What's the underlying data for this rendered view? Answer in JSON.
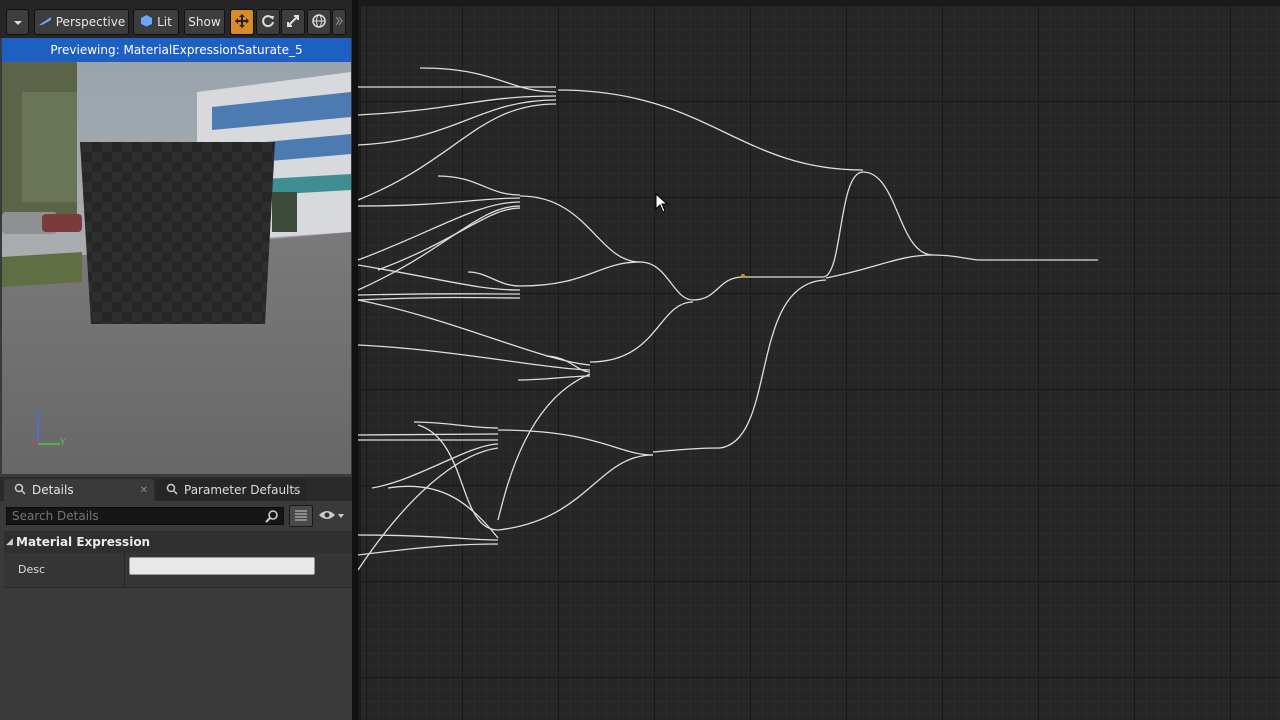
{
  "toolbar": {
    "perspective_label": "Perspective",
    "lit_label": "Lit",
    "show_label": "Show"
  },
  "preview": {
    "header": "Previewing: MaterialExpressionSaturate_5",
    "axis_z": "Z",
    "axis_y": "Y"
  },
  "tabs": {
    "details_label": "Details",
    "parameter_defaults_label": "Parameter Defaults"
  },
  "details": {
    "search_placeholder": "Search Details",
    "category": "Material Expression",
    "desc_label": "Desc",
    "desc_value": ""
  },
  "colors": {
    "accent_orange": "#d98b2b",
    "header_blue": "#1e5fc2",
    "wire": "#e8e8e8",
    "graph_bg": "#262626"
  },
  "icons": [
    "dropdown-arrow-icon",
    "perspective-icon",
    "lit-icon",
    "translate-icon",
    "rotate-icon",
    "scale-icon",
    "world-local-icon",
    "cylinder-icon",
    "sphere-icon",
    "plane-icon",
    "cube-icon",
    "custom-mesh-icon",
    "search-icon",
    "list-view-icon",
    "eye-icon",
    "cursor-icon"
  ]
}
